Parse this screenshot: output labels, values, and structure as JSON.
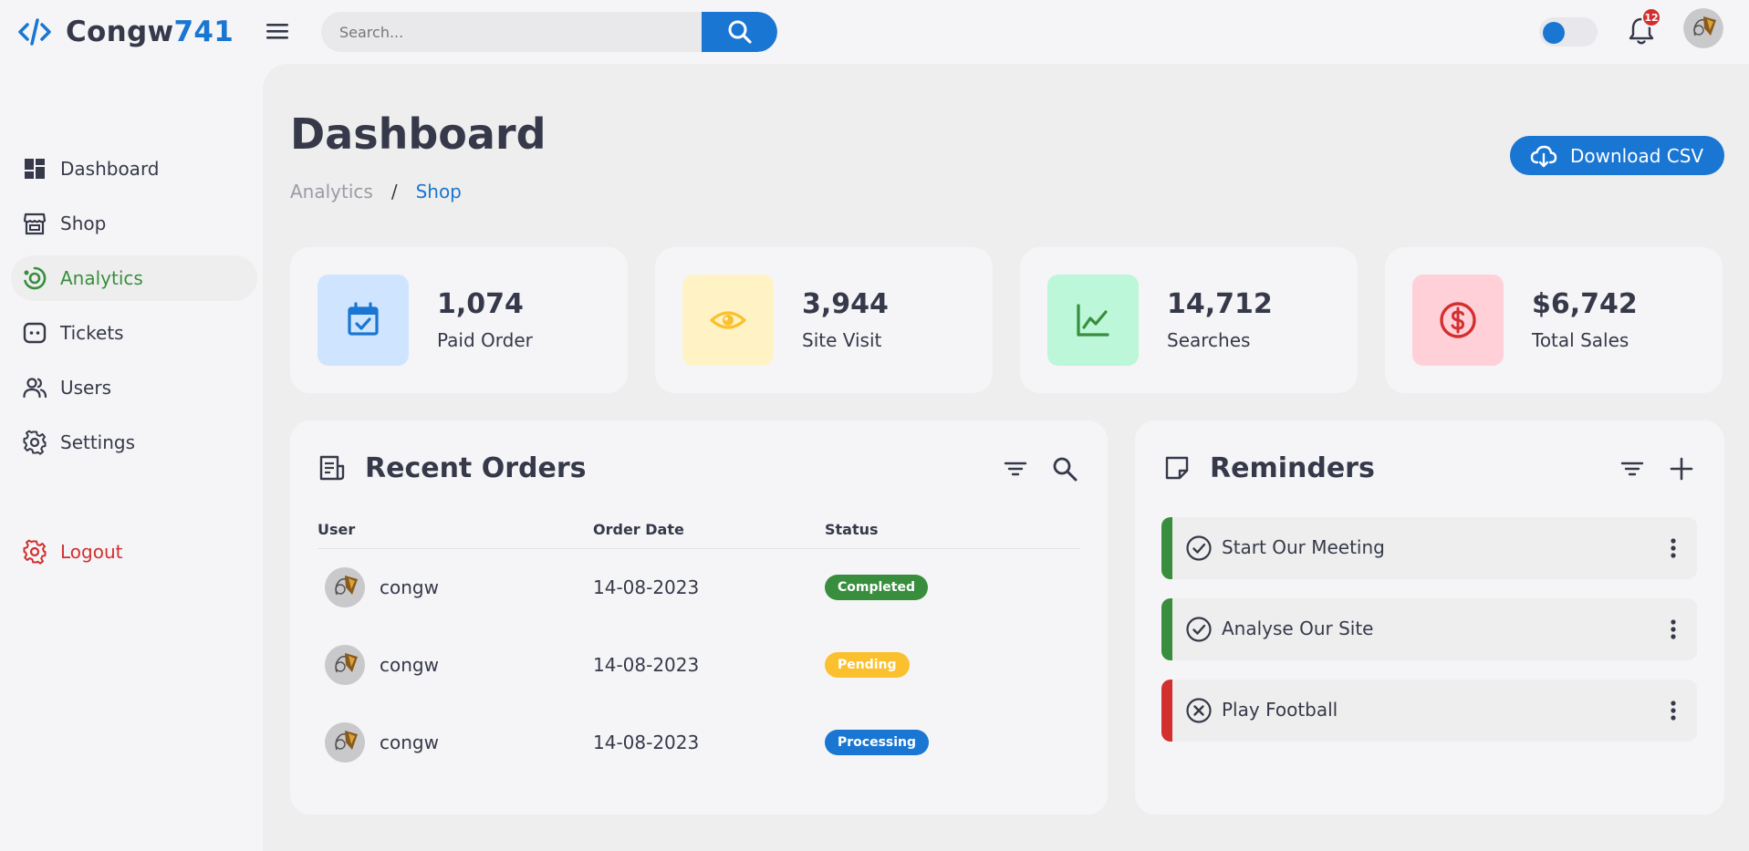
{
  "app": {
    "name_prefix": "Congw",
    "name_suffix": "741",
    "accent_color": "#1976d2"
  },
  "header": {
    "search_placeholder": "Search...",
    "notification_count": "12",
    "theme_toggle_state": "light"
  },
  "sidebar": {
    "items": [
      {
        "label": "Dashboard",
        "icon": "dashboard-icon"
      },
      {
        "label": "Shop",
        "icon": "store-icon"
      },
      {
        "label": "Analytics",
        "icon": "analytics-icon",
        "active": true
      },
      {
        "label": "Tickets",
        "icon": "ticket-icon"
      },
      {
        "label": "Users",
        "icon": "users-icon"
      },
      {
        "label": "Settings",
        "icon": "gear-icon"
      }
    ],
    "logout_label": "Logout"
  },
  "page": {
    "title": "Dashboard",
    "breadcrumb": [
      "Analytics",
      "/",
      "Shop"
    ],
    "download_label": "Download CSV"
  },
  "stats": [
    {
      "value": "1,074",
      "label": "Paid Order",
      "icon": "calendar-check-icon",
      "color": "#1976d2",
      "bg": "#cfe5ff"
    },
    {
      "value": "3,944",
      "label": "Site Visit",
      "icon": "eye-icon",
      "color": "#fbc02d",
      "bg": "#fff3c6"
    },
    {
      "value": "14,712",
      "label": "Searches",
      "icon": "line-chart-icon",
      "color": "#388e3c",
      "bg": "#bbf7d8"
    },
    {
      "value": "$6,742",
      "label": "Total Sales",
      "icon": "dollar-circle-icon",
      "color": "#d32f2f",
      "bg": "#ffd0d8"
    }
  ],
  "orders": {
    "title": "Recent Orders",
    "columns": [
      "User",
      "Order Date",
      "Status"
    ],
    "rows": [
      {
        "user": "congw",
        "date": "14-08-2023",
        "status": "Completed",
        "status_color": "#388e3c"
      },
      {
        "user": "congw",
        "date": "14-08-2023",
        "status": "Pending",
        "status_color": "#fbc02d"
      },
      {
        "user": "congw",
        "date": "14-08-2023",
        "status": "Processing",
        "status_color": "#1976d2"
      }
    ]
  },
  "reminders": {
    "title": "Reminders",
    "items": [
      {
        "text": "Start Our Meeting",
        "state": "done",
        "color": "#388e3c"
      },
      {
        "text": "Analyse Our Site",
        "state": "done",
        "color": "#388e3c"
      },
      {
        "text": "Play Football",
        "state": "cancelled",
        "color": "#d32f2f"
      }
    ]
  }
}
